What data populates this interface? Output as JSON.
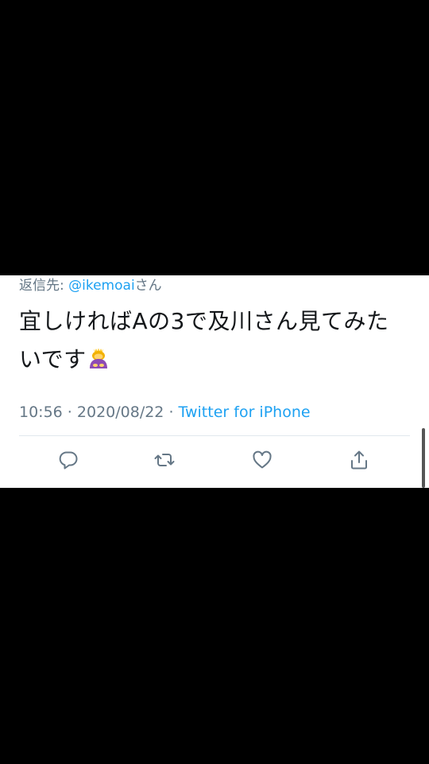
{
  "reply": {
    "prefix": "返信先: ",
    "handle": "@ikemoai",
    "suffix": "さん"
  },
  "tweet": {
    "text_line1": "宜しければAの3で及川さん見てみた",
    "text_line2": "いです",
    "emoji": "bowing-woman-emoji"
  },
  "meta": {
    "time": "10:56",
    "separator1": " · ",
    "date": "2020/08/22",
    "separator2": " · ",
    "source": "Twitter for iPhone"
  },
  "colors": {
    "accent": "#1da1f2",
    "secondary_text": "#657786",
    "primary_text": "#14171a",
    "icon": "#657786"
  },
  "actions": [
    {
      "icon": "reply-icon"
    },
    {
      "icon": "retweet-icon"
    },
    {
      "icon": "like-icon"
    },
    {
      "icon": "share-icon"
    }
  ]
}
